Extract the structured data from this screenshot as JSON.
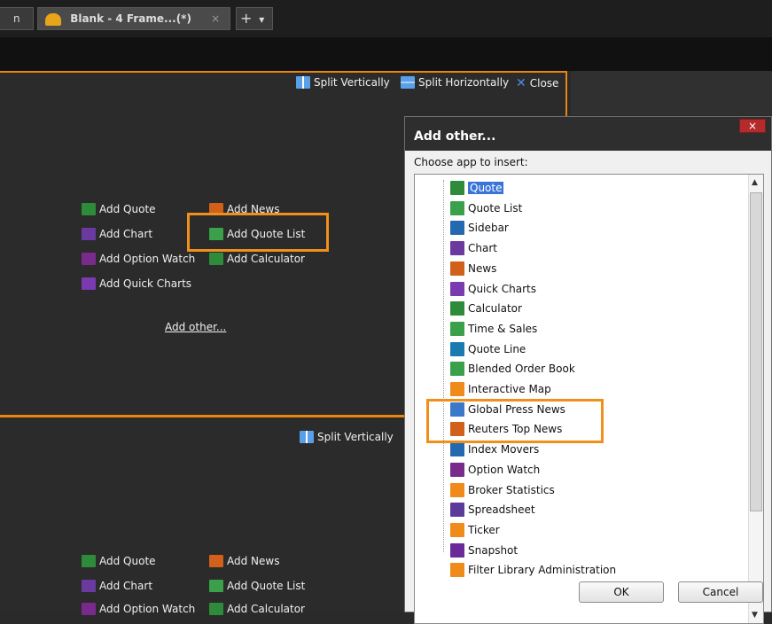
{
  "tabs": {
    "partial_label": "n",
    "active_label": "Blank - 4 Frame...(*)",
    "close_glyph": "×",
    "add_glyph": "+",
    "dropdown_glyph": "▾"
  },
  "frame_top": {
    "split_vertically": "Split Vertically",
    "split_horizontally": "Split Horizontally",
    "close": "Close",
    "links": {
      "add_quote": "Add Quote",
      "add_news": "Add News",
      "add_chart": "Add Chart",
      "add_quote_list": "Add Quote List",
      "add_option_watch": "Add Option Watch",
      "add_calculator": "Add Calculator",
      "add_quick_charts": "Add Quick Charts",
      "add_other": "Add other..."
    }
  },
  "frame_bottom": {
    "split_vertically": "Split Vertically",
    "links": {
      "add_quote": "Add Quote",
      "add_news": "Add News",
      "add_chart": "Add Chart",
      "add_quote_list": "Add Quote List",
      "add_option_watch": "Add Option Watch",
      "add_calculator": "Add Calculator"
    }
  },
  "dialog": {
    "title": "Add other...",
    "close_glyph": "×",
    "prompt": "Choose app to insert:",
    "items": [
      {
        "label": "Quote",
        "icon": "quote-icon",
        "color": "#2e8b3a",
        "selected": true
      },
      {
        "label": "Quote List",
        "icon": "quote-list-icon",
        "color": "#3aa04a"
      },
      {
        "label": "Sidebar",
        "icon": "sidebar-icon",
        "color": "#2468b0"
      },
      {
        "label": "Chart",
        "icon": "chart-icon",
        "color": "#6a3aa0"
      },
      {
        "label": "News",
        "icon": "news-icon",
        "color": "#d0601a"
      },
      {
        "label": "Quick Charts",
        "icon": "quick-charts-icon",
        "color": "#7a3ab0"
      },
      {
        "label": "Calculator",
        "icon": "calculator-icon",
        "color": "#2e8b3a"
      },
      {
        "label": "Time & Sales",
        "icon": "time-sales-icon",
        "color": "#3aa04a"
      },
      {
        "label": "Quote Line",
        "icon": "quote-line-icon",
        "color": "#1a7ab0"
      },
      {
        "label": "Blended Order Book",
        "icon": "order-book-icon",
        "color": "#3aa04a"
      },
      {
        "label": "Interactive Map",
        "icon": "interactive-map-icon",
        "color": "#f08a1a"
      },
      {
        "label": "Global Press News",
        "icon": "globe-icon",
        "color": "#3a78c8"
      },
      {
        "label": "Reuters Top News",
        "icon": "reuters-news-icon",
        "color": "#d0601a"
      },
      {
        "label": "Index Movers",
        "icon": "index-movers-icon",
        "color": "#2468b0"
      },
      {
        "label": "Option Watch",
        "icon": "option-watch-icon",
        "color": "#7a2a8a"
      },
      {
        "label": "Broker Statistics",
        "icon": "broker-statistics-icon",
        "color": "#f08a1a"
      },
      {
        "label": "Spreadsheet",
        "icon": "spreadsheet-icon",
        "color": "#5a3a9a"
      },
      {
        "label": "Ticker",
        "icon": "ticker-icon",
        "color": "#f08a1a"
      },
      {
        "label": "Snapshot",
        "icon": "snapshot-icon",
        "color": "#6a2a9a"
      },
      {
        "label": "Filter Library Administration",
        "icon": "filter-icon",
        "color": "#f08a1a"
      }
    ],
    "ok": "OK",
    "cancel": "Cancel"
  }
}
